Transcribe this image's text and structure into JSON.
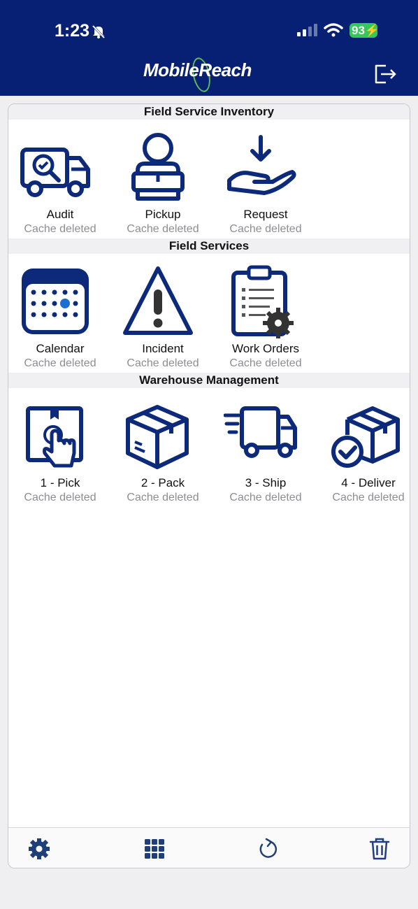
{
  "status_bar": {
    "time": "1:23",
    "battery": "93"
  },
  "header": {
    "logo_text": "MobileReach",
    "logout_icon": "logout-icon"
  },
  "sections": [
    {
      "title": "Field Service Inventory",
      "tiles": [
        {
          "label": "Audit",
          "sub": "Cache deleted",
          "icon": "truck-search-icon"
        },
        {
          "label": "Pickup",
          "sub": "Cache deleted",
          "icon": "person-box-icon"
        },
        {
          "label": "Request",
          "sub": "Cache deleted",
          "icon": "hand-receive-icon"
        }
      ]
    },
    {
      "title": "Field Services",
      "tiles": [
        {
          "label": "Calendar",
          "sub": "Cache deleted",
          "icon": "calendar-icon"
        },
        {
          "label": "Incident",
          "sub": "Cache deleted",
          "icon": "warning-icon"
        },
        {
          "label": "Work Orders",
          "sub": "Cache deleted",
          "icon": "clipboard-gear-icon"
        }
      ]
    },
    {
      "title": "Warehouse Management",
      "tiles": [
        {
          "label": "1 - Pick",
          "sub": "Cache deleted",
          "icon": "pick-icon"
        },
        {
          "label": "2 - Pack",
          "sub": "Cache deleted",
          "icon": "box-icon"
        },
        {
          "label": "3 - Ship",
          "sub": "Cache deleted",
          "icon": "delivery-truck-icon"
        },
        {
          "label": "4 - Deliver",
          "sub": "Cache deleted",
          "icon": "box-check-icon"
        }
      ]
    }
  ],
  "footer": {
    "icons": [
      "gear-icon",
      "grid-icon",
      "refresh-icon",
      "trash-icon"
    ]
  },
  "colors": {
    "brand": "#082073",
    "icon": "#0d2a7a",
    "accent": "#1a6fd1",
    "muted": "#8e8e93"
  }
}
